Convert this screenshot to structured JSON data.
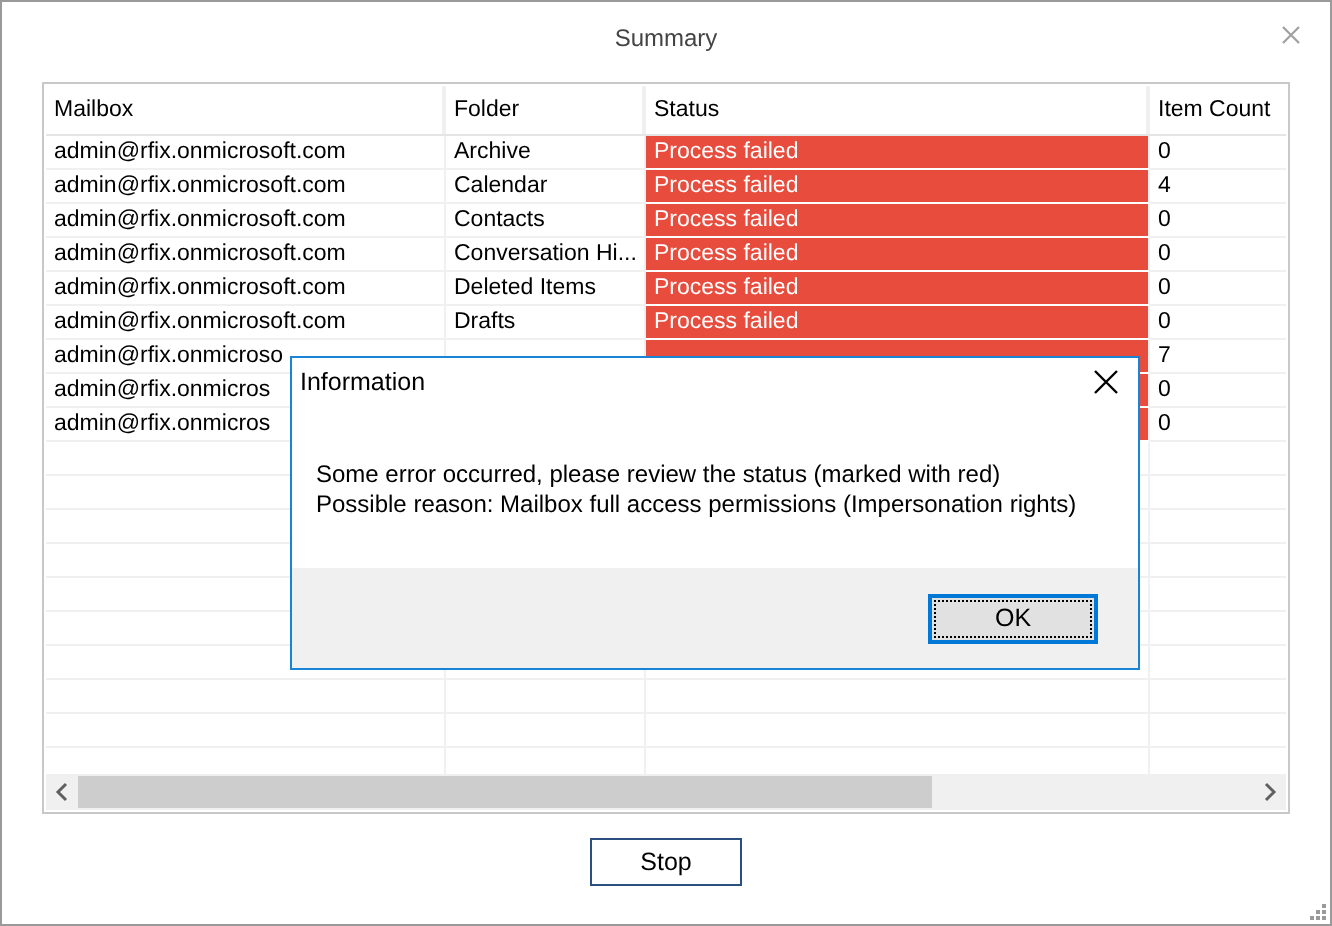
{
  "window": {
    "title": "Summary"
  },
  "table": {
    "columns": [
      "Mailbox",
      "Folder",
      "Status",
      "Item Count"
    ],
    "rows": [
      {
        "mailbox": "admin@rfix.onmicrosoft.com",
        "folder": "Archive",
        "status": "Process failed",
        "failed": true,
        "item_count": "0"
      },
      {
        "mailbox": "admin@rfix.onmicrosoft.com",
        "folder": "Calendar",
        "status": "Process failed",
        "failed": true,
        "item_count": "4"
      },
      {
        "mailbox": "admin@rfix.onmicrosoft.com",
        "folder": "Contacts",
        "status": "Process failed",
        "failed": true,
        "item_count": "0"
      },
      {
        "mailbox": "admin@rfix.onmicrosoft.com",
        "folder": "Conversation Hi...",
        "status": "Process failed",
        "failed": true,
        "item_count": "0"
      },
      {
        "mailbox": "admin@rfix.onmicrosoft.com",
        "folder": "Deleted Items",
        "status": "Process failed",
        "failed": true,
        "item_count": "0"
      },
      {
        "mailbox": "admin@rfix.onmicrosoft.com",
        "folder": "Drafts",
        "status": "Process failed",
        "failed": true,
        "item_count": "0"
      },
      {
        "mailbox": "admin@rfix.onmicroso",
        "failed": true,
        "item_count": "7"
      },
      {
        "mailbox": "admin@rfix.onmicros",
        "failed": true,
        "item_count": "0"
      },
      {
        "mailbox": "admin@rfix.onmicros",
        "failed": true,
        "item_count": "0"
      }
    ]
  },
  "dialog": {
    "title": "Information",
    "message_lines": [
      "Some error occurred, please review the status (marked with red)",
      "Possible reason: Mailbox full access permissions (Impersonation rights)"
    ],
    "buttons": [
      {
        "label": "OK",
        "focused": true
      }
    ]
  },
  "buttons": [
    {
      "label": "Stop"
    }
  ]
}
